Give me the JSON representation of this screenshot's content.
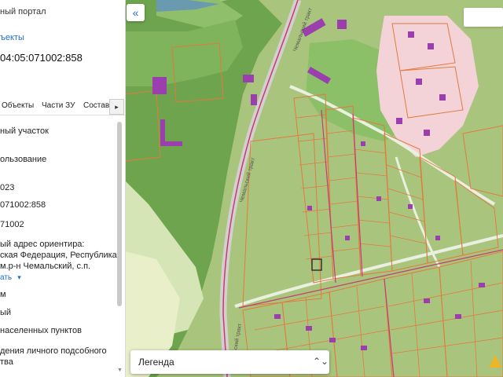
{
  "panel": {
    "portal_title": "ный портал",
    "objects_link": "ъекты",
    "cadastral_number": "04:05:071002:858",
    "tabs": [
      {
        "label": "Объекты"
      },
      {
        "label": "Части ЗУ"
      },
      {
        "label": "Состав"
      }
    ],
    "tabs_next": "▸",
    "fields": [
      "ный участок",
      "ользование",
      "023",
      "071002:858",
      "71002",
      "ый адрес ориентира:",
      "ская Федерация, Республика",
      "м.р-н Чемальский, с.п.",
      "м",
      "ый",
      "населенных пунктов",
      "дения личного подсобного",
      "тва"
    ],
    "show_link": "ать",
    "show_chevron": "▾"
  },
  "map": {
    "collapse_icon": "«",
    "road_labels": [
      "Чемальский тракт",
      "Чемальский тракт",
      "Чемальский тракт"
    ],
    "legend_label": "Легенда",
    "legend_arrows": "⌃⌄"
  },
  "colors": {
    "forest": "#6fa34e",
    "meadow": "#a8c37c",
    "parcel_border": "#e27a3f",
    "road_border": "#c73a73",
    "building": "#9b3fae",
    "link": "#1f6fd1"
  }
}
